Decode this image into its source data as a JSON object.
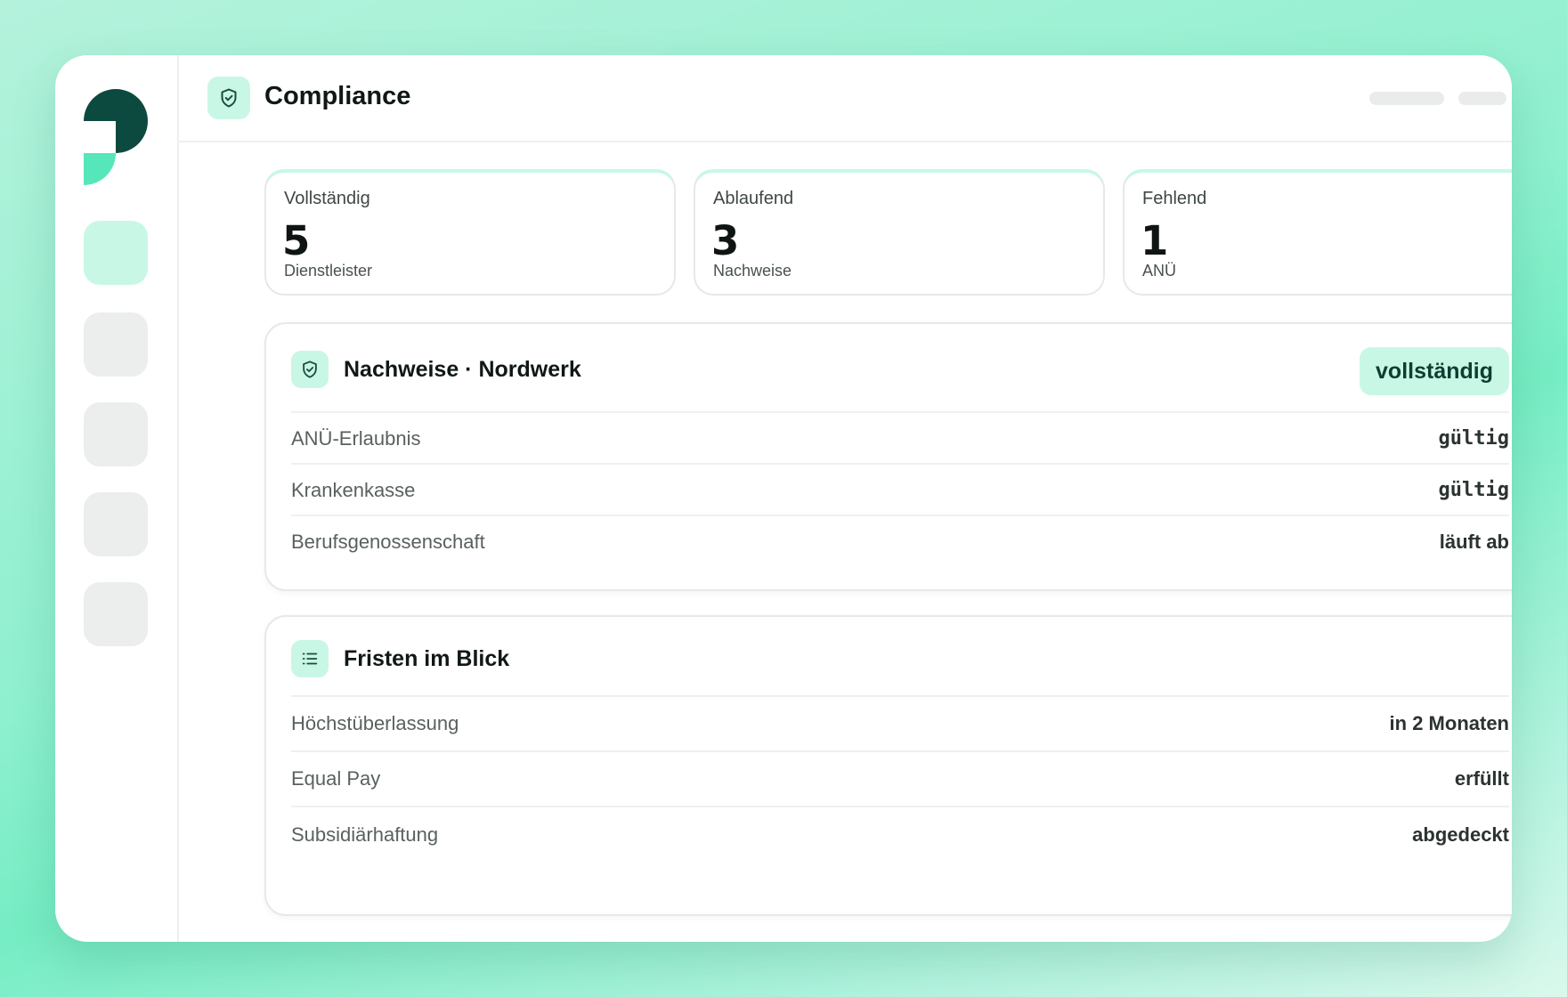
{
  "header": {
    "title": "Compliance",
    "icon": "shield-check-icon"
  },
  "colors": {
    "accent": "#55e6b9",
    "accent_light": "#c9f7e6",
    "brand_dark": "#0c4a40"
  },
  "sidebar": {
    "logo": "brand-logo",
    "items": [
      "nav-item-1",
      "nav-item-2",
      "nav-item-3",
      "nav-item-4",
      "nav-item-5"
    ]
  },
  "stats": [
    {
      "label": "Vollständig",
      "value": "5",
      "sub": "Dienstleister"
    },
    {
      "label": "Ablaufend",
      "value": "3",
      "sub": "Nachweise"
    },
    {
      "label": "Fehlend",
      "value": "1",
      "sub": "ANÜ"
    }
  ],
  "nachweise": {
    "title": "Nachweise · Nordwerk",
    "badge": "vollständig",
    "rows": [
      {
        "label": "ANÜ-Erlaubnis",
        "value": "gültig"
      },
      {
        "label": "Krankenkasse",
        "value": "gültig"
      },
      {
        "label": "Berufsgenossenschaft",
        "value": "läuft ab"
      }
    ]
  },
  "fristen": {
    "title": "Fristen im Blick",
    "rows": [
      {
        "label": "Höchstüberlassung",
        "value": "in 2 Monaten"
      },
      {
        "label": "Equal Pay",
        "value": "erfüllt"
      },
      {
        "label": "Subsidiärhaftung",
        "value": "abgedeckt"
      }
    ]
  }
}
